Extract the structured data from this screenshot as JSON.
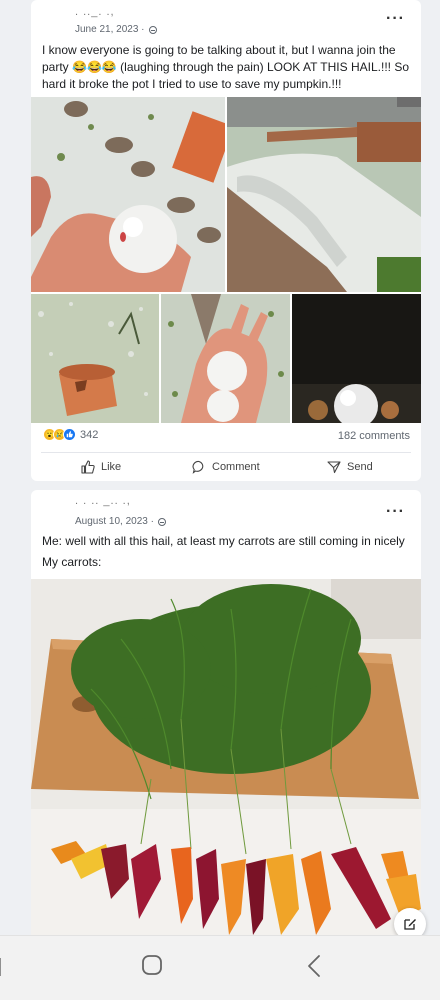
{
  "post1": {
    "author": ". .._. .,",
    "date": "June 21, 2023 ·",
    "more_label": "···",
    "text": "I know everyone is going to be talking about it, but I wanna join the party 😂😂😂 (laughing through the pain) LOOK AT THIS HAIL.!!! So hard it broke the pot I tried to use to save my pumpkin.!!!",
    "reaction_count": "342",
    "comments_count": "182 comments",
    "actions": {
      "like": "Like",
      "comment": "Comment",
      "send": "Send"
    }
  },
  "post2": {
    "author": ". .  .. _.. .,",
    "date": "August 10, 2023 ·",
    "more_label": "···",
    "text_line1": "Me: well with all this hail, at least my carrots are still coming in nicely",
    "text_line2": "My carrots:"
  },
  "colors": {
    "like_blue": "#1877f2",
    "haha_yellow": "#f7b928",
    "page_bg": "#eef0f3"
  },
  "icons": [
    "globe-icon",
    "more-icon",
    "like-icon",
    "comment-icon",
    "send-icon",
    "recent-apps-icon",
    "home-icon",
    "back-icon",
    "compose-icon"
  ]
}
